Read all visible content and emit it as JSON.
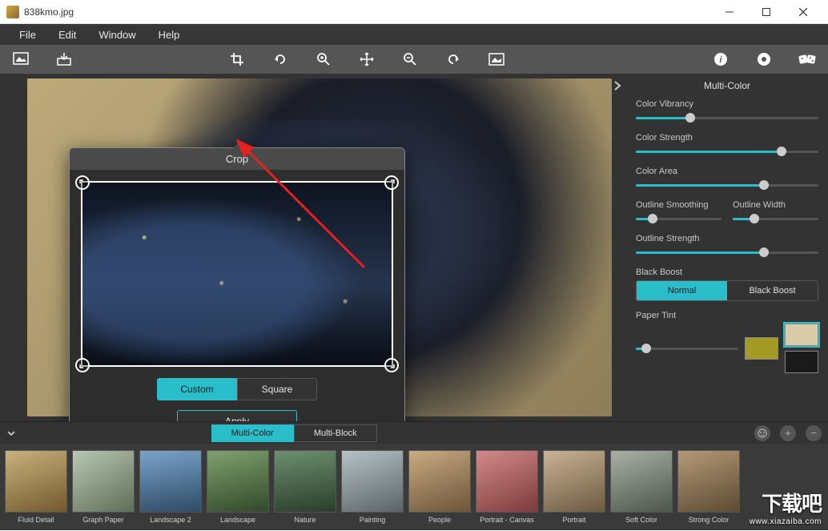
{
  "window": {
    "title": "838kmo.jpg"
  },
  "menu": {
    "file": "File",
    "edit": "Edit",
    "window": "Window",
    "help": "Help"
  },
  "crop_panel": {
    "title": "Crop",
    "custom": "Custom",
    "square": "Square",
    "apply": "Apply"
  },
  "side": {
    "title": "Multi-Color",
    "vibrancy": {
      "label": "Color Vibrancy",
      "value": 30
    },
    "strength": {
      "label": "Color Strength",
      "value": 80
    },
    "area": {
      "label": "Color Area",
      "value": 70
    },
    "smoothing": {
      "label": "Outline Smoothing",
      "value": 20
    },
    "width": {
      "label": "Outline Width",
      "value": 25
    },
    "ostrength": {
      "label": "Outline Strength",
      "value": 70
    },
    "black_boost": {
      "label": "Black Boost",
      "normal": "Normal",
      "boost": "Black Boost"
    },
    "tint": {
      "label": "Paper Tint",
      "value": 10,
      "swatch1": "#a39a23",
      "swatch2": "#d9cba8",
      "swatch3": "#1a1a1a"
    }
  },
  "filter_tabs": {
    "multi_color": "Multi-Color",
    "multi_block": "Multi-Block"
  },
  "presets": [
    "Fluid Detail",
    "Graph Paper",
    "Landscape 2",
    "Landscape",
    "Nature",
    "Painting",
    "People",
    "Portrait - Canvas",
    "Portrait",
    "Soft Color",
    "Strong Color"
  ],
  "watermark": {
    "big": "下载吧",
    "small": "www.xiazaiba.com"
  }
}
